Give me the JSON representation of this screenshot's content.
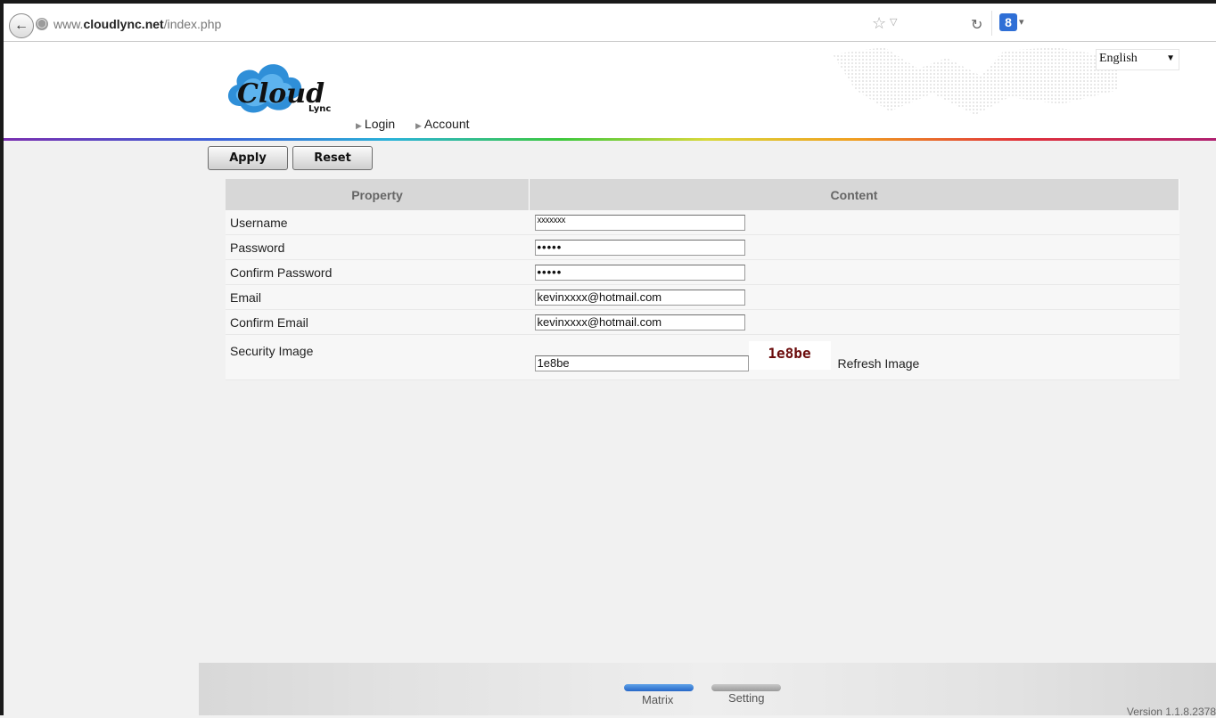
{
  "browser": {
    "url_prefix": "www.",
    "url_domain": "cloudlync.net",
    "url_path": "/index.php"
  },
  "header": {
    "logo_text": "Cloud",
    "logo_subtext": "Lync",
    "nav": [
      {
        "label": "Login"
      },
      {
        "label": "Account"
      }
    ],
    "language": "English"
  },
  "toolbar": {
    "apply_label": "Apply",
    "reset_label": "Reset"
  },
  "table": {
    "headers": [
      "Property",
      "Content"
    ],
    "rows": [
      {
        "label": "Username",
        "value": "xxxxxxx"
      },
      {
        "label": "Password",
        "value": "•••••"
      },
      {
        "label": "Confirm Password",
        "value": "•••••"
      },
      {
        "label": "Email",
        "value": "kevinxxxx@hotmail.com"
      },
      {
        "label": "Confirm Email",
        "value": "kevinxxxx@hotmail.com"
      }
    ],
    "security": {
      "label": "Security Image",
      "value": "1e8be",
      "captcha_text": "1e8be",
      "refresh_label": "Refresh Image"
    }
  },
  "footer": {
    "tabs": [
      {
        "label": "Matrix",
        "active": true
      },
      {
        "label": "Setting",
        "active": false
      }
    ],
    "version": "Version 1.1.8.2378"
  },
  "colors": {
    "active_tab": "#2667c8",
    "captcha_text": "#6b0c0c",
    "page_background": "#f1f1f1"
  }
}
